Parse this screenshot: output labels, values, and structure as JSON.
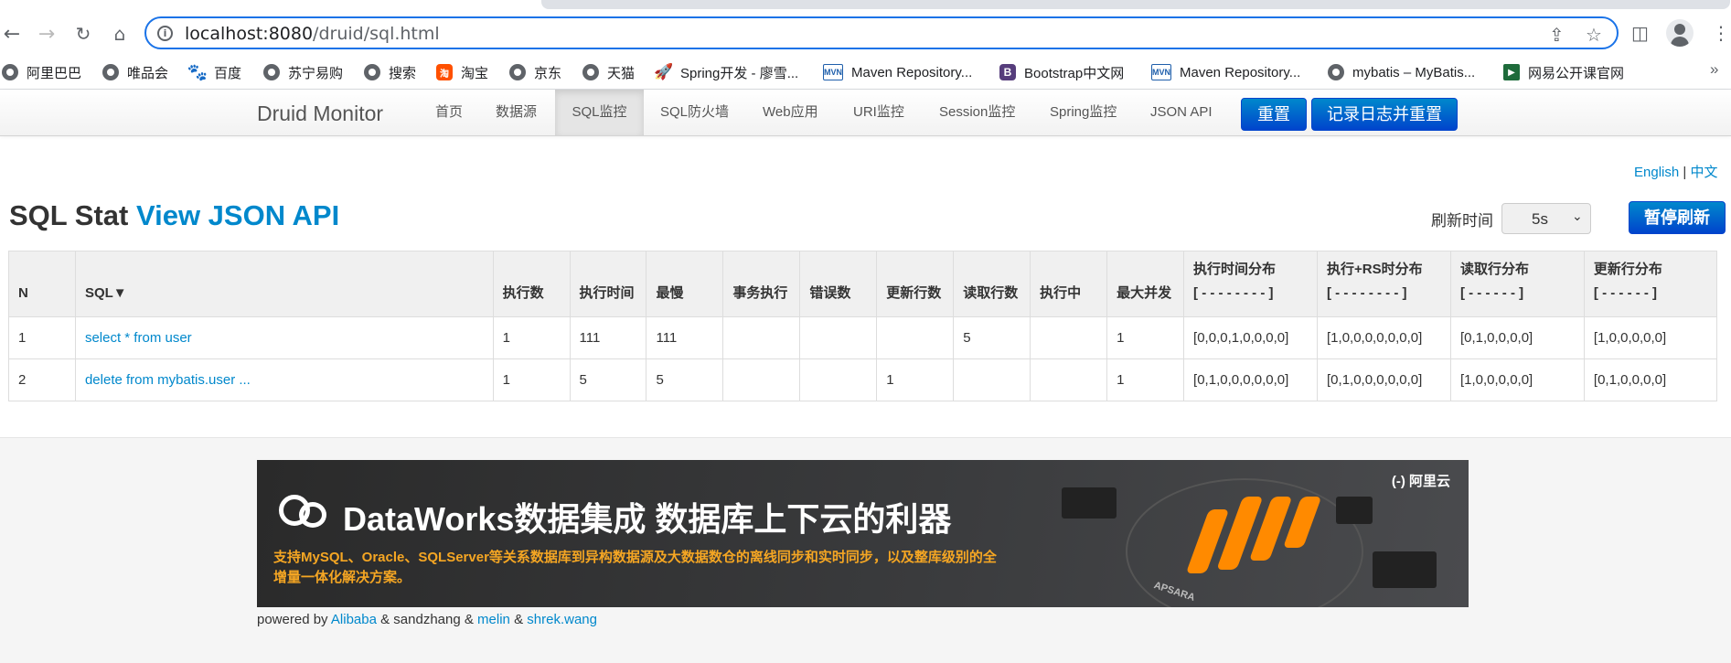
{
  "browser": {
    "url_host": "localhost:8080",
    "url_path": "/druid/sql.html",
    "bookmarks": [
      "阿里巴巴",
      "唯品会",
      "百度",
      "苏宁易购",
      "搜索",
      "淘宝",
      "京东",
      "天猫",
      "Spring开发 - 廖雪...",
      "Maven Repository...",
      "Bootstrap中文网",
      "Maven Repository...",
      "mybatis – MyBatis...",
      "网易公开课官网"
    ],
    "more": "»"
  },
  "nav": {
    "brand": "Druid Monitor",
    "links": [
      "首页",
      "数据源",
      "SQL监控",
      "SQL防火墙",
      "Web应用",
      "URI监控",
      "Session监控",
      "Spring监控",
      "JSON API"
    ],
    "active": "SQL监控",
    "reset": "重置",
    "log_reset": "记录日志并重置"
  },
  "lang": {
    "english": "English",
    "sep": "|",
    "chinese": "中文"
  },
  "page": {
    "title": "SQL Stat",
    "json_link": "View JSON API",
    "refresh_label": "刷新时间",
    "refresh_value": "5s",
    "pause": "暂停刷新"
  },
  "table": {
    "headers": [
      "N",
      "SQL▼",
      "执行数",
      "执行时间",
      "最慢",
      "事务执行",
      "错误数",
      "更新行数",
      "读取行数",
      "执行中",
      "最大并发",
      "执行时间分布",
      "执行+RS时分布",
      "读取行分布",
      "更新行分布"
    ],
    "header_subs": [
      "[ - - - - - - - - ]",
      "[ - - - - - - - - ]",
      "[ - - - - - - ]",
      "[ - - - - - - ]"
    ],
    "rows": [
      [
        "1",
        "select * from user",
        "1",
        "111",
        "111",
        "",
        "",
        "",
        "5",
        "",
        "1",
        "[0,0,0,1,0,0,0,0]",
        "[1,0,0,0,0,0,0,0]",
        "[0,1,0,0,0,0]",
        "[1,0,0,0,0,0]"
      ],
      [
        "2",
        "delete from mybatis.user ...",
        "1",
        "5",
        "5",
        "",
        "",
        "1",
        "",
        "",
        "1",
        "[0,1,0,0,0,0,0,0]",
        "[0,1,0,0,0,0,0,0]",
        "[1,0,0,0,0,0]",
        "[0,1,0,0,0,0]"
      ]
    ]
  },
  "banner": {
    "headline": "DataWorks数据集成 数据库上下云的利器",
    "desc": "支持MySQL、Oracle、SQLServer等关系数据库到异构数据源及大数据数仓的离线同步和实时同步，以及整库级别的全增量一体化解决方案。",
    "brand": "(-) 阿里云",
    "apsara": "APSARA"
  },
  "footer": {
    "prefix": "powered by",
    "alibaba": "Alibaba",
    "amp1": "& sandzhang &",
    "melin": "melin",
    "amp2": "&",
    "shrek": "shrek.wang"
  }
}
